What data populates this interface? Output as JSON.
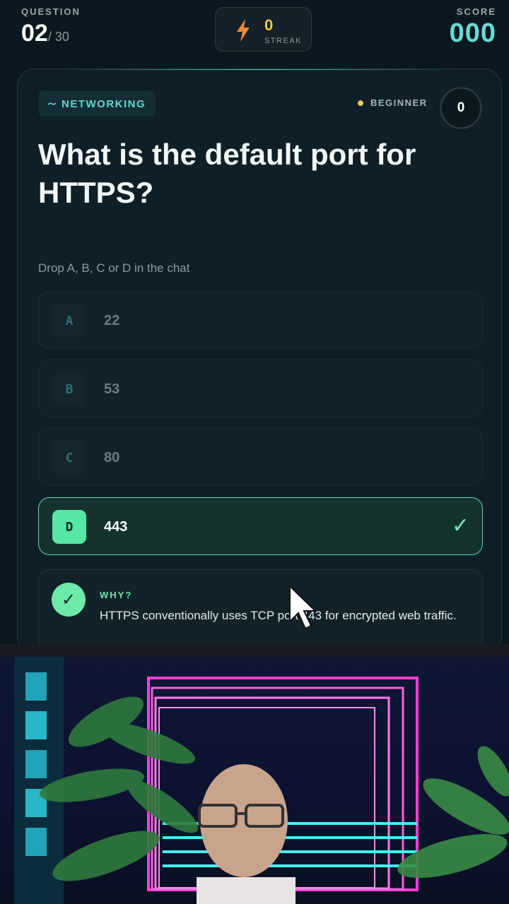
{
  "hud": {
    "question_label": "QUESTION",
    "question_current": "02",
    "question_total": "/ 30",
    "streak_count": "0",
    "streak_label": "STREAK",
    "score_label": "SCORE",
    "score_value": "000"
  },
  "card": {
    "category": "NETWORKING",
    "level": "BEGINNER",
    "timer": "0",
    "question": "What is the default port for HTTPS?",
    "hint": "Drop A, B, C or D in the chat",
    "options": [
      {
        "letter": "A",
        "value": "22"
      },
      {
        "letter": "B",
        "value": "53"
      },
      {
        "letter": "C",
        "value": "80"
      },
      {
        "letter": "D",
        "value": "443"
      }
    ],
    "correct_letter": "D",
    "why_label": "WHY?",
    "why_text": "HTTPS conventionally uses TCP port 443 for encrypted web traffic."
  },
  "colors": {
    "accent": "#5fd6d1",
    "correct": "#56e7a5",
    "streak": "#f5c84a"
  }
}
